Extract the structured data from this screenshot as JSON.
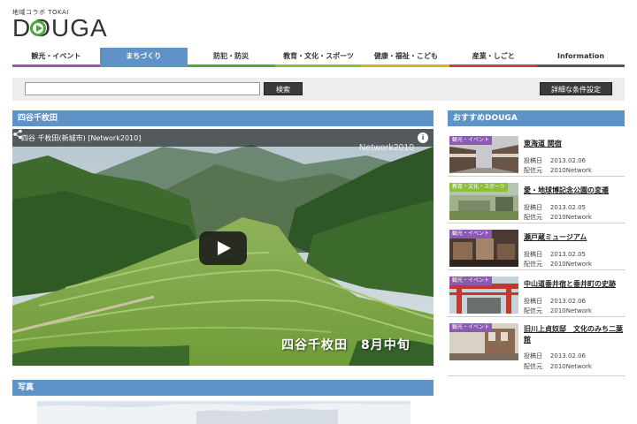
{
  "logo": {
    "small": "地域コラボ TOKAI",
    "main": "DOUGA"
  },
  "nav": [
    {
      "label": "観光・イベント",
      "color": "#8c5bb0"
    },
    {
      "label": "まちづくり",
      "color": "#5f93c8"
    },
    {
      "label": "防犯・防災",
      "color": "#4caa3c"
    },
    {
      "label": "教育・文化・スポーツ",
      "color": "#8dbf3c"
    },
    {
      "label": "健康・福祉・こども",
      "color": "#d8b02a"
    },
    {
      "label": "産業・しごと",
      "color": "#c8404a"
    },
    {
      "label": "Information",
      "color": "#555555"
    }
  ],
  "search": {
    "value": "",
    "button": "検索",
    "detail": "詳細な条件設定"
  },
  "main": {
    "title": "四谷千枚田",
    "video_title": "四谷 千枚田(新城市) [Network2010]",
    "watermark": "Network2010",
    "caption": "四谷千枚田　8月中旬",
    "photo_heading": "写真"
  },
  "sidebar": {
    "heading": "おすすめDOUGA",
    "items": [
      {
        "badge": "観光・イベント",
        "badge_color": "#8c5bb0",
        "title": "東海道 関宿",
        "date_label": "投稿日",
        "date": "2013.02.06",
        "source_label": "配信元",
        "source": "2010Network"
      },
      {
        "badge": "教育・文化・スポーツ",
        "badge_color": "#8dbf3c",
        "title": "愛・地球博記念公園の変遷",
        "date_label": "投稿日",
        "date": "2013.02.05",
        "source_label": "配信元",
        "source": "2010Network"
      },
      {
        "badge": "観光・イベント",
        "badge_color": "#8c5bb0",
        "title": "瀬戸蔵ミュージアム",
        "date_label": "投稿日",
        "date": "2013.02.05",
        "source_label": "配信元",
        "source": "2010Network"
      },
      {
        "badge": "観光・イベント",
        "badge_color": "#8c5bb0",
        "title": "中山道垂井宿と垂井町の史跡",
        "date_label": "投稿日",
        "date": "2013.02.06",
        "source_label": "配信元",
        "source": "2010Network"
      },
      {
        "badge": "観光・イベント",
        "badge_color": "#8c5bb0",
        "title": "旧川上貞奴邸　文化のみち二葉館",
        "date_label": "投稿日",
        "date": "2013.02.06",
        "source_label": "配信元",
        "source": "2010Network"
      }
    ]
  }
}
